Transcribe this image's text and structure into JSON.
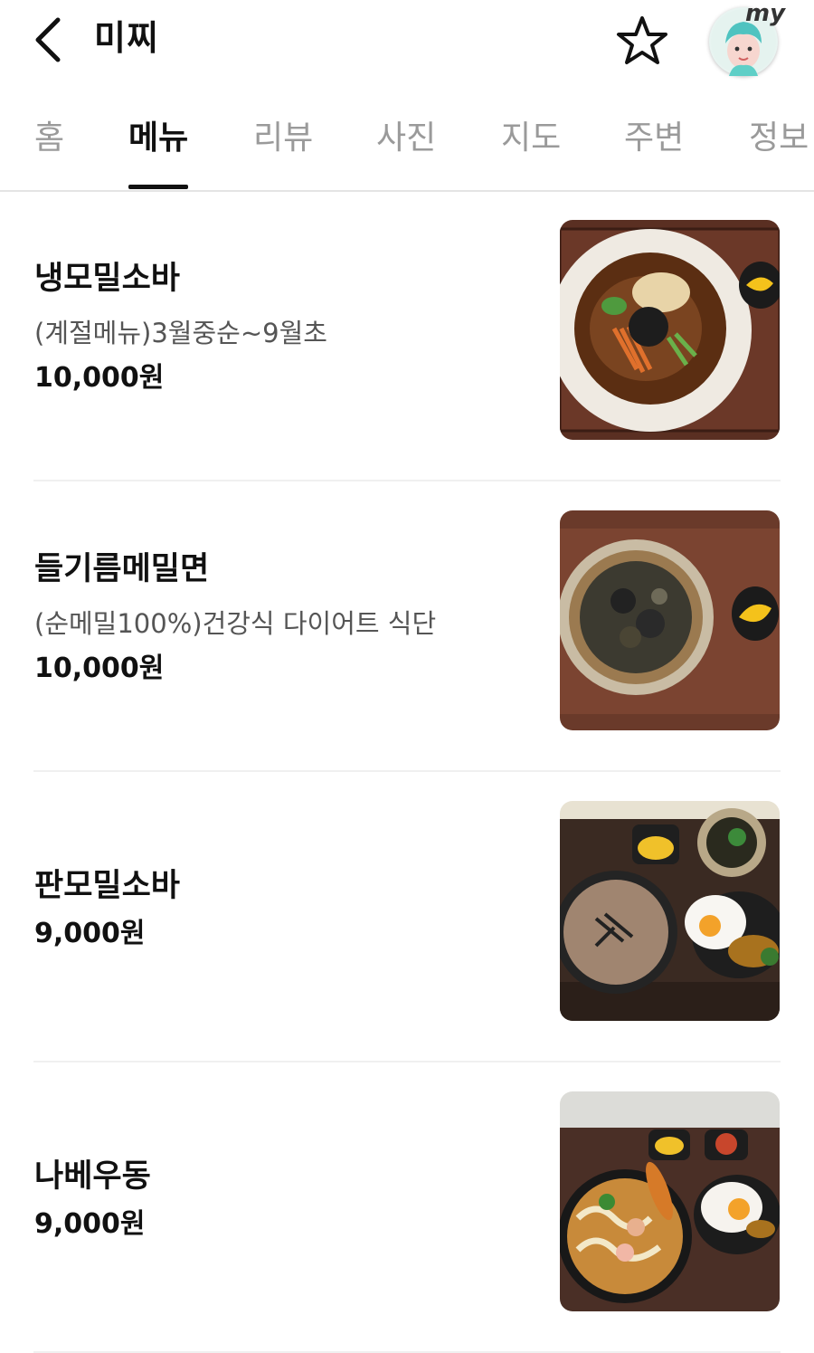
{
  "header": {
    "title": "미찌",
    "back_icon": "chevron-left-icon",
    "favorite_icon": "star-outline-icon",
    "avatar_badge": "my"
  },
  "tabs": [
    {
      "label": "홈",
      "active": false
    },
    {
      "label": "메뉴",
      "active": true
    },
    {
      "label": "리뷰",
      "active": false
    },
    {
      "label": "사진",
      "active": false
    },
    {
      "label": "지도",
      "active": false
    },
    {
      "label": "주변",
      "active": false
    },
    {
      "label": "정보",
      "active": false
    }
  ],
  "menu": [
    {
      "name": "냉모밀소바",
      "desc": "(계절메뉴)3월중순~9월초",
      "price": "10,000원"
    },
    {
      "name": "들기름메밀면",
      "desc": "(순메밀100%)건강식 다이어트 식단",
      "price": "10,000원"
    },
    {
      "name": "판모밀소바",
      "price": "9,000원"
    },
    {
      "name": "나베우동",
      "price": "9,000원"
    }
  ]
}
